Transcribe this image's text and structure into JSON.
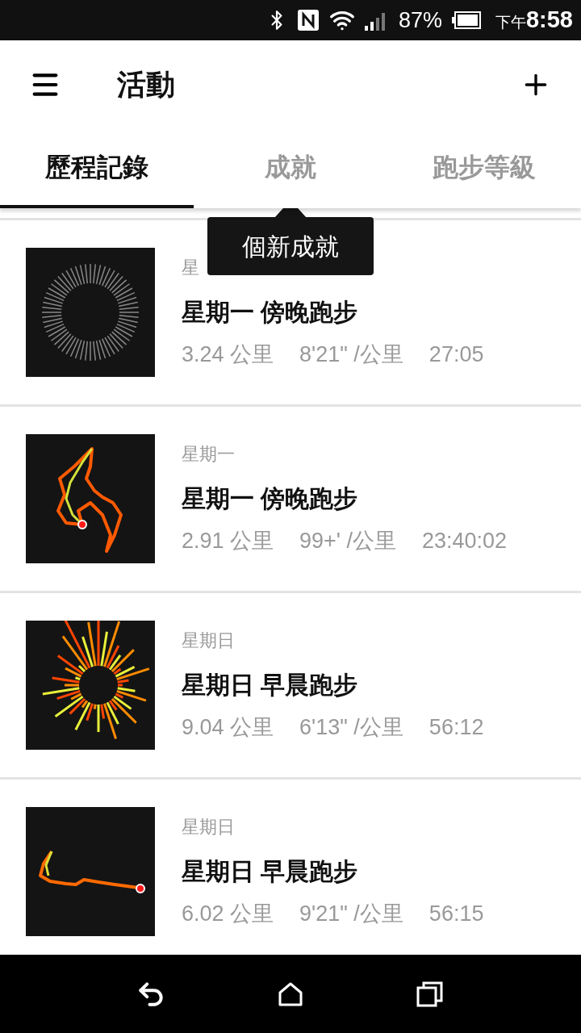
{
  "status_bar": {
    "battery": "87%",
    "ampm": "下午",
    "time": "8:58"
  },
  "header": {
    "title": "活動"
  },
  "tabs": [
    {
      "label": "歷程記錄",
      "selected": true
    },
    {
      "label": "成就",
      "selected": false
    },
    {
      "label": "跑步等級",
      "selected": false
    }
  ],
  "tooltip": {
    "text": "個新成就"
  },
  "activities": [
    {
      "kind": "rings",
      "day": "星",
      "title": "星期一 傍晚跑步",
      "distance": "3.24 公里",
      "pace": "8'21\" /公里",
      "duration": "27:05"
    },
    {
      "kind": "route",
      "day": "星期一",
      "title": "星期一 傍晚跑步",
      "distance": "2.91 公里",
      "pace": "99+' /公里",
      "duration": "23:40:02"
    },
    {
      "kind": "burst",
      "day": "星期日",
      "title": "星期日 早晨跑步",
      "distance": "9.04 公里",
      "pace": "6'13\" /公里",
      "duration": "56:12"
    },
    {
      "kind": "line",
      "day": "星期日",
      "title": "星期日 早晨跑步",
      "distance": "6.02 公里",
      "pace": "9'21\" /公里",
      "duration": "56:15"
    }
  ]
}
